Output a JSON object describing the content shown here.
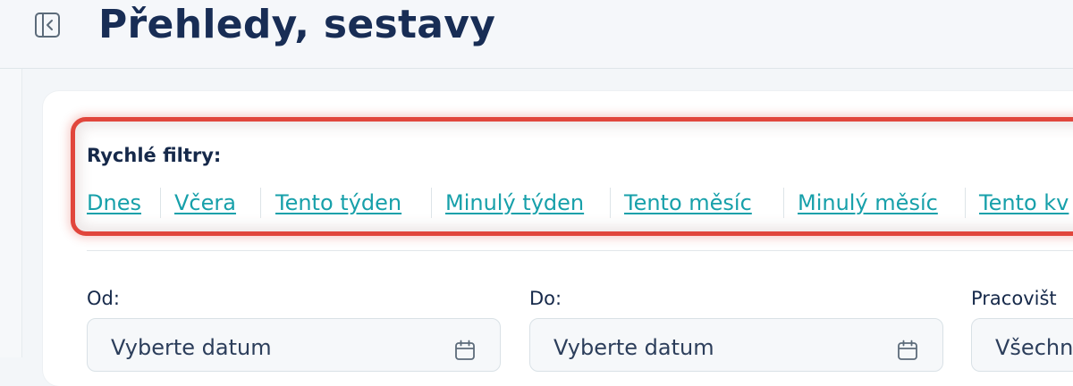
{
  "header": {
    "title": "Přehledy, sestavy",
    "toggle_icon": "sidebar-collapse-icon"
  },
  "quick_filters": {
    "label": "Rychlé filtry:",
    "links": [
      {
        "label": "Dnes"
      },
      {
        "label": "Včera"
      },
      {
        "label": "Tento týden"
      },
      {
        "label": "Minulý týden"
      },
      {
        "label": "Tento měsíc"
      },
      {
        "label": "Minulý měsíc"
      },
      {
        "label": "Tento kv"
      }
    ],
    "link_color": "#17a0aa",
    "highlight_color": "#e1463c"
  },
  "filters": {
    "from": {
      "label": "Od:",
      "placeholder": "Vyberte datum",
      "icon": "calendar-icon"
    },
    "to": {
      "label": "Do:",
      "placeholder": "Vyberte datum",
      "icon": "calendar-icon"
    },
    "workplace": {
      "label": "Pracovišt",
      "value": "Všechn"
    }
  }
}
